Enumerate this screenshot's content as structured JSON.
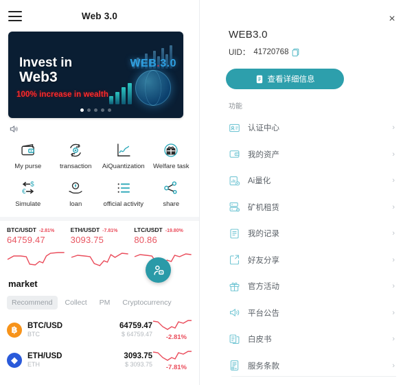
{
  "left": {
    "topbar": {
      "title": "Web 3.0",
      "menu_icon": "hamburger-icon"
    },
    "banner": {
      "headline_line1": "Invest in",
      "headline_line2": "Web3",
      "subtitle": "100% increase in wealth",
      "brand": "WEB",
      "brand_suffix": "3.0",
      "dots_total": 5,
      "active_dot": 1
    },
    "notice": {
      "icon": "speaker-icon"
    },
    "shortcuts": [
      {
        "label": "My purse",
        "icon": "wallet-icon"
      },
      {
        "label": "transaction",
        "icon": "exchange-icon"
      },
      {
        "label": "AiQuantization",
        "icon": "line-chart-icon"
      },
      {
        "label": "Welfare task",
        "icon": "gift-icon"
      },
      {
        "label": "Simulate",
        "icon": "currency-swap-icon"
      },
      {
        "label": "loan",
        "icon": "hand-coin-icon"
      },
      {
        "label": "official activity",
        "icon": "list-icon"
      },
      {
        "label": "share",
        "icon": "share-icon"
      }
    ],
    "tickers": [
      {
        "pair": "BTC/USDT",
        "change": "-2.81%",
        "price": "64759.47"
      },
      {
        "pair": "ETH/USDT",
        "change": "-7.81%",
        "price": "3093.75"
      },
      {
        "pair": "LTC/USDT",
        "change": "-19.80%",
        "price": "80.86"
      }
    ],
    "market": {
      "title": "market",
      "tabs": [
        {
          "label": "Recommend",
          "active": true
        },
        {
          "label": "Collect",
          "active": false
        },
        {
          "label": "PM",
          "active": false
        },
        {
          "label": "Cryptocurrency",
          "active": false
        }
      ],
      "rows": [
        {
          "pair": "BTC/USD",
          "symbol": "BTC",
          "price": "64759.47",
          "usd": "$ 64759.47",
          "change": "-2.81%",
          "logo_glyph": "฿",
          "logo_color": "#f7931a"
        },
        {
          "pair": "ETH/USD",
          "symbol": "ETH",
          "price": "3093.75",
          "usd": "$ 3093.75",
          "change": "-7.81%",
          "logo_glyph": "◆",
          "logo_color": "#2a5ada"
        }
      ]
    },
    "fab": {
      "icon": "customer-service-icon",
      "color": "#2a9aa8"
    }
  },
  "right": {
    "close_label": "×",
    "title": "WEB3.0",
    "uid_label": "UID：",
    "uid_value": "41720768",
    "copy_icon": "copy-icon",
    "detail_button": {
      "label": "查看详细信息",
      "icon": "document-icon",
      "color": "#2d9fac"
    },
    "section_label": "功能",
    "menu": [
      {
        "label": "认证中心",
        "icon": "id-card-icon"
      },
      {
        "label": "我的资产",
        "icon": "wallet-icon"
      },
      {
        "label": "Ai量化",
        "icon": "chart-bar-icon"
      },
      {
        "label": "矿机租赁",
        "icon": "server-icon"
      },
      {
        "label": "我的记录",
        "icon": "file-text-icon"
      },
      {
        "label": "好友分享",
        "icon": "share-box-icon"
      },
      {
        "label": "官方活动",
        "icon": "gift-icon"
      },
      {
        "label": "平台公告",
        "icon": "megaphone-icon"
      },
      {
        "label": "白皮书",
        "icon": "book-icon"
      },
      {
        "label": "服务条款",
        "icon": "contract-icon"
      }
    ],
    "chevron": "›"
  }
}
